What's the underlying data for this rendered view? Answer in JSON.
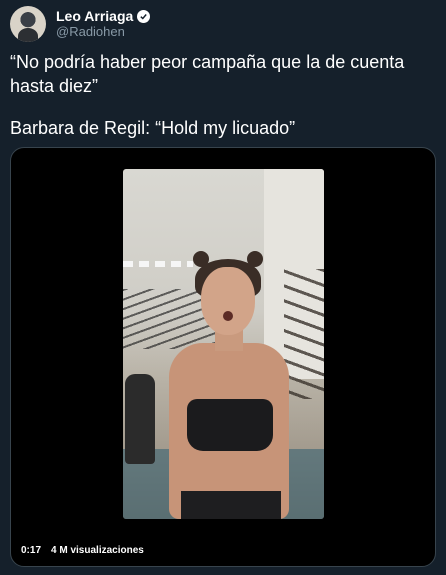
{
  "author": {
    "display_name": "Leo Arriaga",
    "handle": "@Radiohen",
    "verified_icon": "verified-badge-icon"
  },
  "tweet": {
    "line1": "“No podría haber peor campaña que la de cuenta",
    "line2": "hasta diez”",
    "line3": "Barbara de Regil: “Hold my licuado”"
  },
  "video": {
    "time": "0:17",
    "views": "4 M visualizaciones"
  },
  "colors": {
    "background": "#15202b",
    "text_primary": "#ffffff",
    "text_secondary": "#8899a6",
    "media_border": "#38444d"
  }
}
